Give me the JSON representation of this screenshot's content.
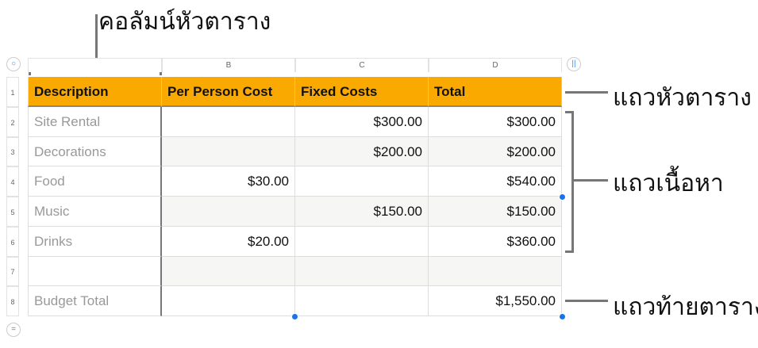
{
  "annotations": {
    "header_column": "คอลัมน์หัวตาราง",
    "header_row": "แถวหัวตาราง",
    "body_rows": "แถวเนื้อหา",
    "footer_row": "แถวท้ายตาราง"
  },
  "column_letters": [
    "",
    "B",
    "C",
    "D"
  ],
  "row_numbers": [
    "1",
    "2",
    "3",
    "4",
    "5",
    "6",
    "7",
    "8"
  ],
  "table": {
    "headers": [
      "Description",
      "Per Person Cost",
      "Fixed Costs",
      "Total"
    ],
    "rows": [
      [
        "Site Rental",
        "",
        "$300.00",
        "$300.00"
      ],
      [
        "Decorations",
        "",
        "$200.00",
        "$200.00"
      ],
      [
        "Food",
        "$30.00",
        "",
        "$540.00"
      ],
      [
        "Music",
        "",
        "$150.00",
        "$150.00"
      ],
      [
        "Drinks",
        "$20.00",
        "",
        "$360.00"
      ],
      [
        "",
        "",
        "",
        ""
      ],
      [
        "Budget Total",
        "",
        "",
        "$1,550.00"
      ]
    ]
  },
  "colors": {
    "header": "#f9a900",
    "handle": "#1a73e8"
  }
}
